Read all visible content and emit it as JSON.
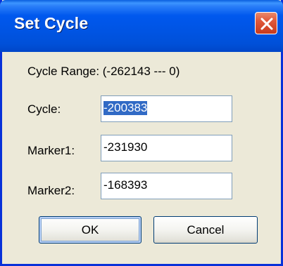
{
  "window": {
    "title": "Set Cycle"
  },
  "dialog": {
    "range_label": "Cycle Range: (-262143 --- 0)",
    "fields": [
      {
        "label": "Cycle:",
        "value": "-200383",
        "selected": true
      },
      {
        "label": "Marker1:",
        "value": "-231930",
        "selected": false
      },
      {
        "label": "Marker2:",
        "value": "-168393",
        "selected": false
      }
    ],
    "buttons": {
      "ok_label": "OK",
      "cancel_label": "Cancel"
    }
  },
  "colors": {
    "titlebar_blue": "#0054e3",
    "dialog_background": "#ece9d8",
    "close_red": "#e0583a",
    "selection_blue": "#316ac5"
  },
  "icons": {
    "close": "close-x-icon"
  }
}
